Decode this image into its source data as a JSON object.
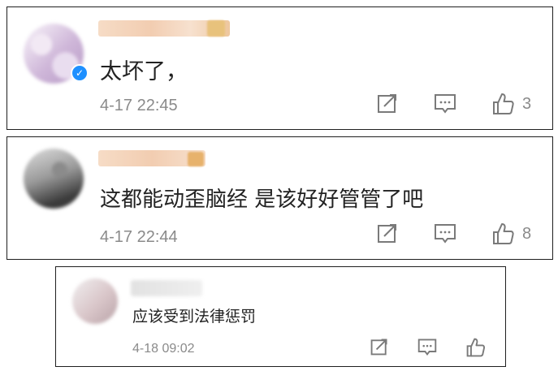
{
  "comments": [
    {
      "text": "太坏了，",
      "time": "4-17 22:45",
      "like_count": "3",
      "verified": true
    },
    {
      "text": "这都能动歪脑经  是该好好管管了吧",
      "time": "4-17 22:44",
      "like_count": "8",
      "verified": false
    },
    {
      "text": "应该受到法律惩罚",
      "time": "4-18 09:02",
      "like_count": "",
      "verified": false
    }
  ],
  "icons": {
    "share": "share-icon",
    "comment": "comment-icon",
    "like": "thumbs-up-icon",
    "verified": "verified-badge-icon"
  },
  "colors": {
    "verified_blue": "#1e90ff",
    "text": "#222222",
    "meta": "#8a8a8a",
    "border": "#1f1f1f"
  }
}
